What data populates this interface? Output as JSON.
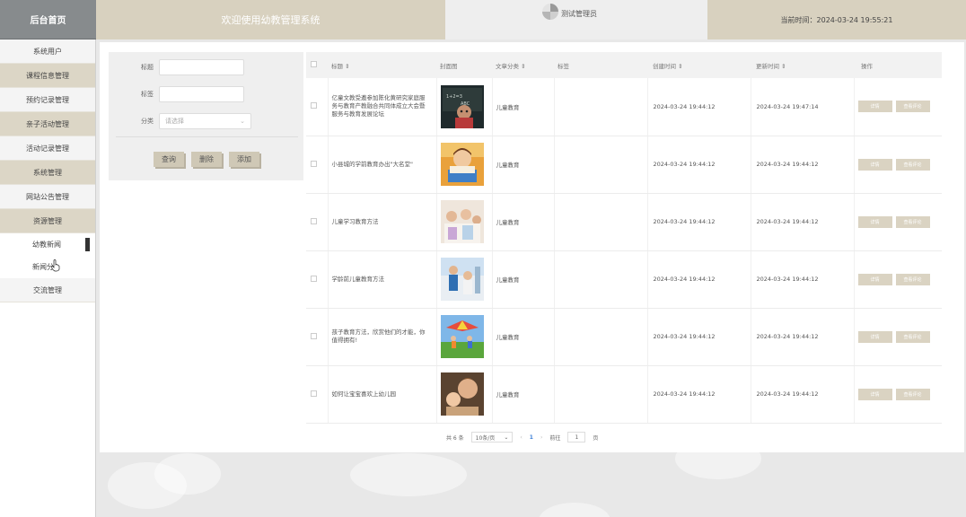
{
  "header": {
    "home_label": "后台首页",
    "welcome_text": "欢迎使用幼教管理系统",
    "username": "测试管理员",
    "time_text": "当前时间：2024-03-24 19:55:21"
  },
  "sidebar": {
    "items": [
      {
        "label": "系统用户"
      },
      {
        "label": "课程信息管理"
      },
      {
        "label": "预约记录管理"
      },
      {
        "label": "亲子活动管理"
      },
      {
        "label": "活动记录管理"
      },
      {
        "label": "系统管理"
      },
      {
        "label": "网站公告管理"
      },
      {
        "label": "资源管理"
      },
      {
        "label": "幼教新闻"
      },
      {
        "label": "新闻分"
      },
      {
        "label": "交流管理"
      }
    ]
  },
  "filter": {
    "title_label": "标题",
    "tag_label": "标签",
    "category_label": "分类",
    "category_placeholder": "请选择",
    "search_button": "查询",
    "delete_button": "删除",
    "add_button": "添加"
  },
  "table": {
    "headers": {
      "title": "标题 ⇕",
      "cover": "封面图",
      "category": "文章分类 ⇕",
      "tags": "标签",
      "created": "创建时间 ⇕",
      "updated": "更新时间 ⇕",
      "actions": "操作"
    },
    "detail_label": "详情",
    "comment_label": "查看评论",
    "rows": [
      {
        "title": "亿童文教受邀参加陈化黄研究家庭服务与教育产教融合共同体成立大会暨服务与教育发展论坛",
        "category": "儿童教育",
        "tags": "",
        "created": "2024-03-24 19:44:12",
        "updated": "2024-03-24 19:47:14"
      },
      {
        "title": "小县城的学前教育办出\"大名堂\"",
        "category": "儿童教育",
        "tags": "",
        "created": "2024-03-24 19:44:12",
        "updated": "2024-03-24 19:44:12"
      },
      {
        "title": "儿童学习教育方法",
        "category": "儿童教育",
        "tags": "",
        "created": "2024-03-24 19:44:12",
        "updated": "2024-03-24 19:44:12"
      },
      {
        "title": "学龄前儿童教育方法",
        "category": "儿童教育",
        "tags": "",
        "created": "2024-03-24 19:44:12",
        "updated": "2024-03-24 19:44:12"
      },
      {
        "title": "孩子教育方法，欣赏他们的才能，你值得拥有!",
        "category": "儿童教育",
        "tags": "",
        "created": "2024-03-24 19:44:12",
        "updated": "2024-03-24 19:44:12"
      },
      {
        "title": "如何让宝宝喜欢上幼儿园",
        "category": "儿童教育",
        "tags": "",
        "created": "2024-03-24 19:44:12",
        "updated": "2024-03-24 19:44:12"
      }
    ]
  },
  "pagination": {
    "total_text": "共 6 条",
    "page_size": "10条/页",
    "prev": "‹",
    "current_page": "1",
    "next": "›",
    "goto_label": "前往",
    "goto_value": "1",
    "page_unit": "页"
  }
}
